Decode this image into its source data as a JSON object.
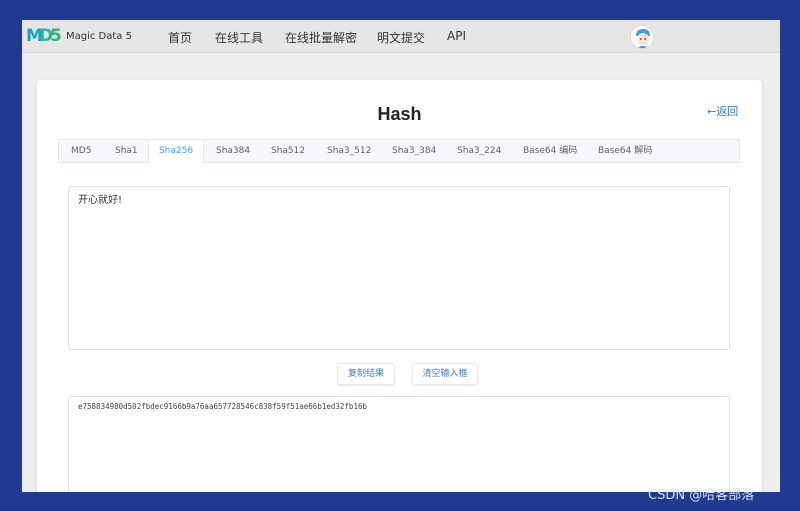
{
  "navbar": {
    "logo_text": "Magic Data 5",
    "logo_mark": [
      "M",
      "D",
      "5"
    ],
    "items": [
      "首页",
      "在线工具",
      "在线批量解密",
      "明文提交",
      "API"
    ]
  },
  "page": {
    "title": "Hash",
    "back_label": "←返回"
  },
  "tabs": {
    "items": [
      "MD5",
      "Sha1",
      "Sha256",
      "Sha384",
      "Sha512",
      "Sha3_512",
      "Sha3_384",
      "Sha3_224",
      "Base64 编码",
      "Base64 解码"
    ],
    "active": "Sha256"
  },
  "input": {
    "value": "开心就好!"
  },
  "buttons": {
    "copy_label": "复制结果",
    "clear_label": "清空输入框"
  },
  "output": {
    "value": "e758834980d502fbdec9166b9a76aa657728546c838f59f51ae66b1ed32fb16b"
  },
  "watermark": "CSDN @哈客部落",
  "colors": {
    "outer_background": "#1f3a8f",
    "accent": "#409eff",
    "link": "#3a7bd5"
  }
}
